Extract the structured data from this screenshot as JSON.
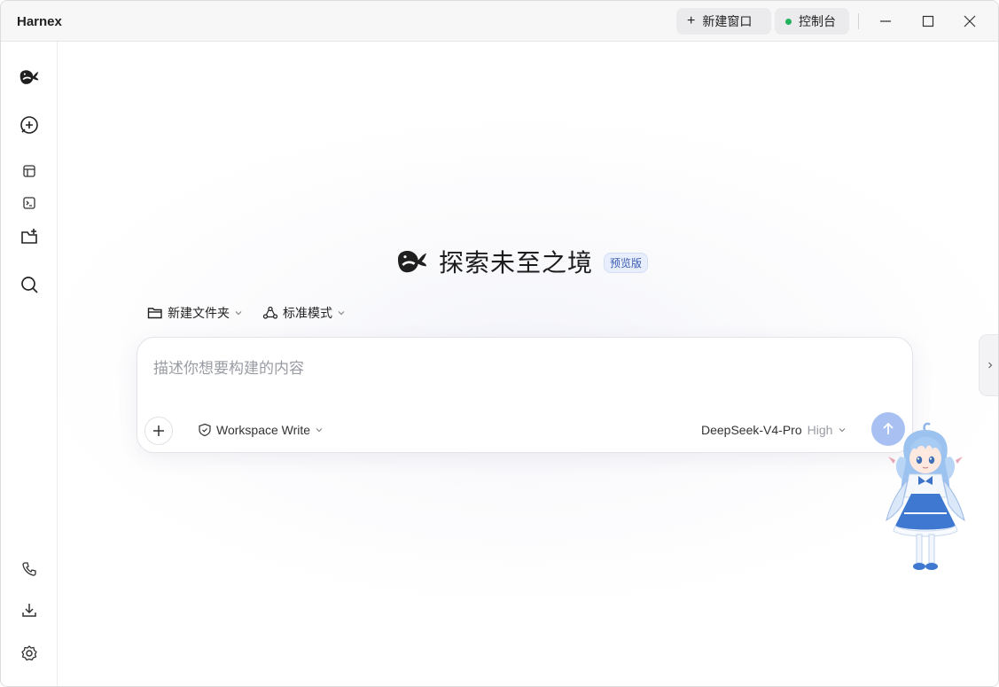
{
  "window": {
    "title": "Harnex",
    "new_window_label": "新建窗口",
    "console_label": "控制台",
    "console_status_color": "#22b35e"
  },
  "sidebar": {
    "icons": [
      "whale-logo-icon",
      "new-chat-icon",
      "layout-icon",
      "terminal-icon",
      "new-folder-icon",
      "search-icon",
      "phone-icon",
      "download-icon",
      "settings-icon"
    ]
  },
  "hero": {
    "title": "探索未至之境",
    "badge": "预览版"
  },
  "selectors": {
    "folder": "新建文件夹",
    "mode": "标准模式"
  },
  "composer": {
    "placeholder": "描述你想要构建的内容",
    "permission": "Workspace Write",
    "model": "DeepSeek-V4-Pro",
    "effort": "High",
    "send_color": "#a9c1f2"
  }
}
